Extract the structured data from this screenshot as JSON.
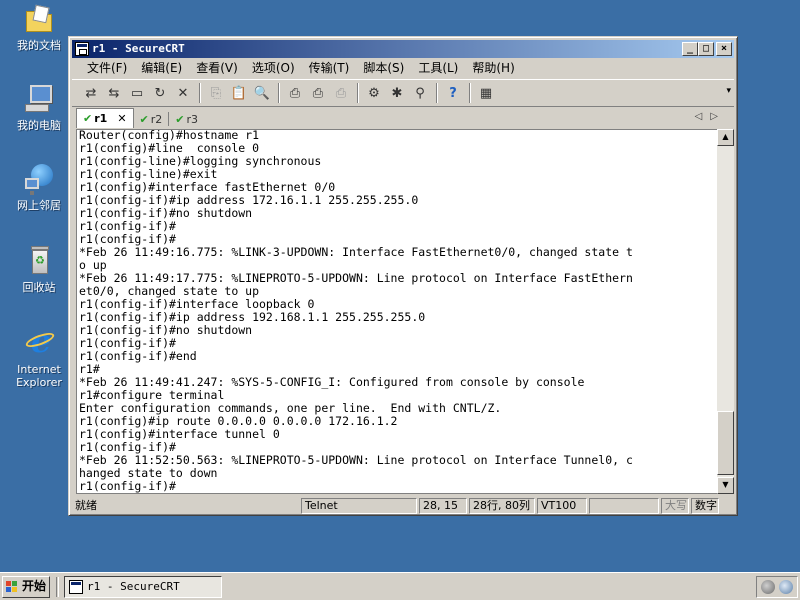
{
  "desktop": {
    "icons": [
      {
        "label": "我的文档"
      },
      {
        "label": "我的电脑"
      },
      {
        "label": "网上邻居"
      },
      {
        "label": "回收站"
      },
      {
        "label": "Internet\nExplorer"
      }
    ]
  },
  "window": {
    "title": "r1 - SecureCRT",
    "caption": {
      "minimize": "_",
      "maximize": "□",
      "close": "×"
    }
  },
  "menu": {
    "items": [
      "文件(F)",
      "编辑(E)",
      "查看(V)",
      "选项(O)",
      "传输(T)",
      "脚本(S)",
      "工具(L)",
      "帮助(H)"
    ]
  },
  "toolbar": {
    "buttons": [
      {
        "icon": "connect-icon",
        "glyph": "⇄"
      },
      {
        "icon": "quick-connect-icon",
        "glyph": "⇆"
      },
      {
        "icon": "connect-in-tab-icon",
        "glyph": "▭"
      },
      {
        "icon": "reconnect-icon",
        "glyph": "↻"
      },
      {
        "icon": "disconnect-icon",
        "glyph": "✕"
      },
      {
        "icon": "copy-icon",
        "glyph": "⎘",
        "dim": true
      },
      {
        "icon": "paste-icon",
        "glyph": "📋"
      },
      {
        "icon": "find-icon",
        "glyph": "🔍"
      },
      {
        "icon": "print-icon",
        "glyph": "⎙"
      },
      {
        "icon": "print-setup-icon",
        "glyph": "⎙"
      },
      {
        "icon": "print-selection-icon",
        "glyph": "⎙",
        "dim": true
      },
      {
        "icon": "session-options-icon",
        "glyph": "⚙"
      },
      {
        "icon": "global-options-icon",
        "glyph": "✱"
      },
      {
        "icon": "keymap-icon",
        "glyph": "⚲"
      },
      {
        "icon": "help-icon",
        "glyph": "?"
      },
      {
        "icon": "about-icon",
        "glyph": "▦"
      }
    ],
    "chevron": "▾"
  },
  "tabs": {
    "items": [
      {
        "label": "r1",
        "active": true
      },
      {
        "label": "r2",
        "active": false
      },
      {
        "label": "r3",
        "active": false
      }
    ],
    "check": "✔",
    "close": "✕",
    "nav": "◁▷"
  },
  "terminal": {
    "lines": [
      "Router(config)#hostname r1",
      "r1(config)#line  console 0",
      "r1(config-line)#logging synchronous",
      "r1(config-line)#exit",
      "r1(config)#interface fastEthernet 0/0",
      "r1(config-if)#ip address 172.16.1.1 255.255.255.0",
      "r1(config-if)#no shutdown",
      "r1(config-if)#",
      "r1(config-if)#",
      "*Feb 26 11:49:16.775: %LINK-3-UPDOWN: Interface FastEthernet0/0, changed state t",
      "o up",
      "*Feb 26 11:49:17.775: %LINEPROTO-5-UPDOWN: Line protocol on Interface FastEthern",
      "et0/0, changed state to up",
      "r1(config-if)#interface loopback 0",
      "r1(config-if)#ip address 192.168.1.1 255.255.255.0",
      "r1(config-if)#no shutdown",
      "r1(config-if)#",
      "r1(config-if)#end",
      "r1#",
      "*Feb 26 11:49:41.247: %SYS-5-CONFIG_I: Configured from console by console",
      "r1#configure terminal",
      "Enter configuration commands, one per line.  End with CNTL/Z.",
      "r1(config)#ip route 0.0.0.0 0.0.0.0 172.16.1.2",
      "r1(config)#interface tunnel 0",
      "r1(config-if)#",
      "*Feb 26 11:52:50.563: %LINEPROTO-5-UPDOWN: Line protocol on Interface Tunnel0, c",
      "hanged state to down",
      "r1(config-if)#"
    ]
  },
  "scrollbar": {
    "up": "▲",
    "down": "▼"
  },
  "status": {
    "ready": "就绪",
    "protocol": "Telnet",
    "cursor": "28, 15",
    "size": "28行, 80列",
    "emulation": "VT100",
    "blank": "",
    "caps": "大写",
    "num": "数字"
  },
  "taskbar": {
    "start": "开始",
    "task_title": "r1 - SecureCRT"
  }
}
